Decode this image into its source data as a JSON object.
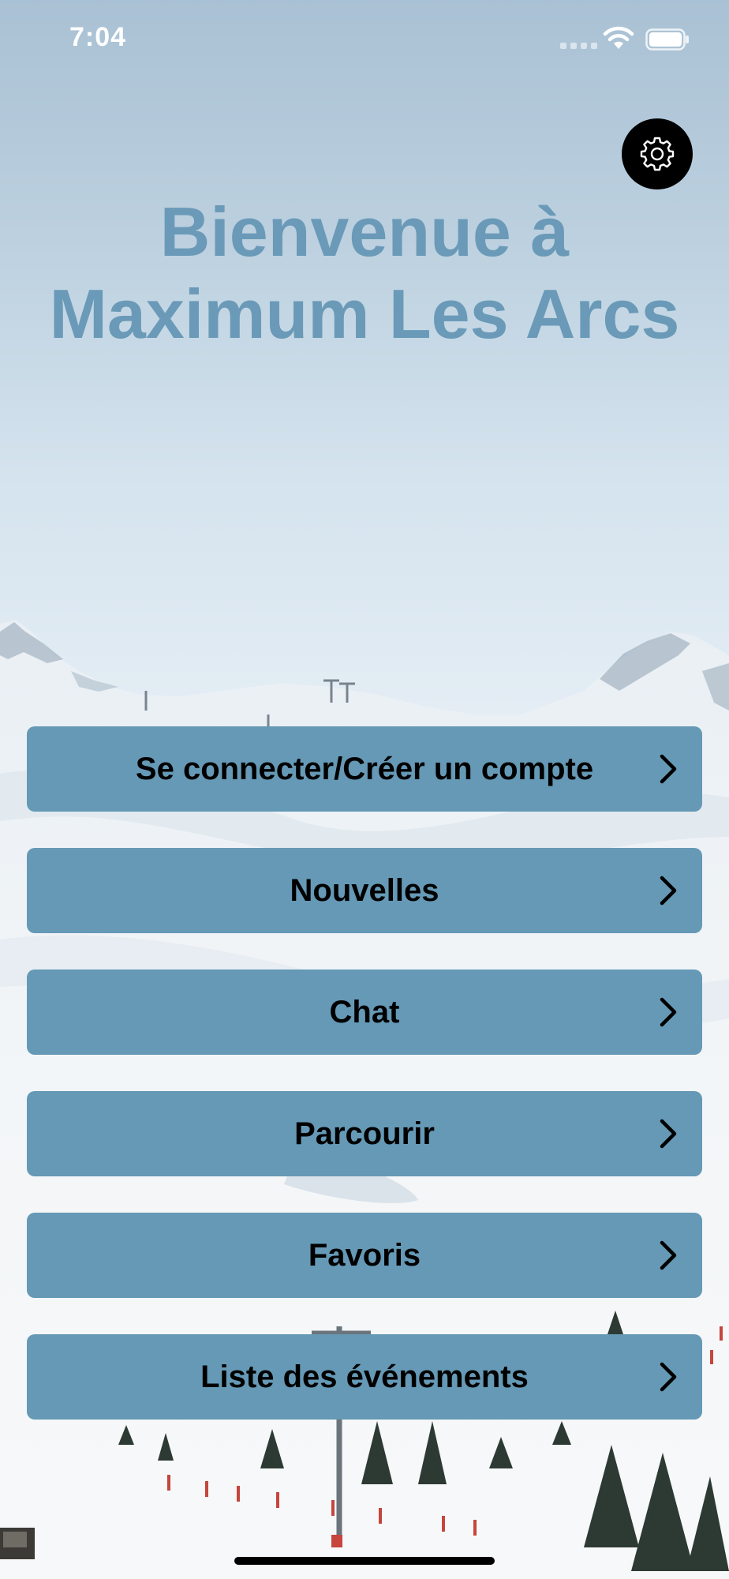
{
  "status_bar": {
    "time": "7:04"
  },
  "header": {
    "title_line1": "Bienvenue à",
    "title_line2": "Maximum Les Arcs"
  },
  "settings": {
    "icon": "gear-icon"
  },
  "menu": {
    "items": [
      {
        "label": "Se connecter/Créer un compte",
        "icon": "chevron-right-icon"
      },
      {
        "label": "Nouvelles",
        "icon": "chevron-right-icon"
      },
      {
        "label": "Chat",
        "icon": "chevron-right-icon"
      },
      {
        "label": "Parcourir",
        "icon": "chevron-right-icon"
      },
      {
        "label": "Favoris",
        "icon": "chevron-right-icon"
      },
      {
        "label": "Liste des événements",
        "icon": "chevron-right-icon"
      }
    ]
  },
  "colors": {
    "button_background": "#6599b6",
    "title_color": "#6a9ab8",
    "button_text": "#000000",
    "settings_background": "#000000"
  }
}
